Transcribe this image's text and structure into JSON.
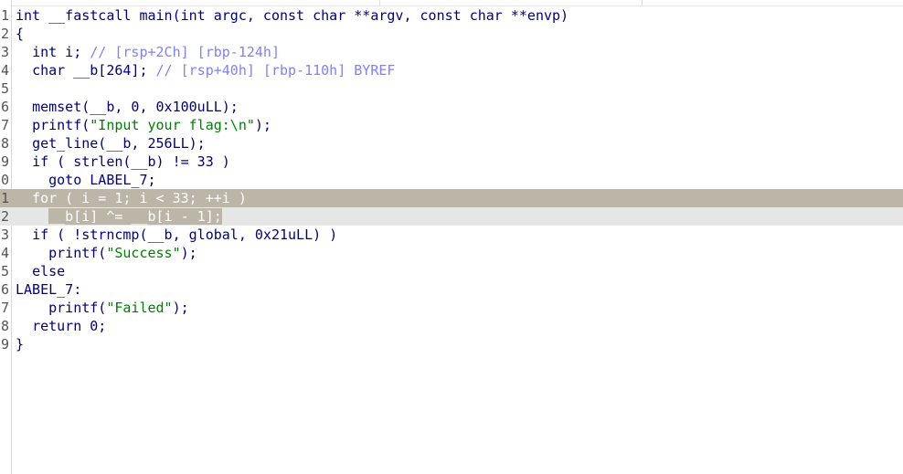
{
  "code_lines": [
    {
      "num": "1",
      "indent": "",
      "text": "int __fastcall main(int argc, const char **argv, const char **envp)",
      "comment": "",
      "str": ""
    },
    {
      "num": "2",
      "indent": "",
      "text": "{",
      "comment": "",
      "str": ""
    },
    {
      "num": "3",
      "indent": "  ",
      "text": "int i; ",
      "comment": "// [rsp+2Ch] [rbp-124h]",
      "str": ""
    },
    {
      "num": "4",
      "indent": "  ",
      "text": "char __b[264]; ",
      "comment": "// [rsp+40h] [rbp-110h] BYREF",
      "str": ""
    },
    {
      "num": "5",
      "indent": "",
      "text": "",
      "comment": "",
      "str": ""
    },
    {
      "num": "6",
      "indent": "  ",
      "text": "memset(__b, 0, 0x100uLL);",
      "comment": "",
      "str": ""
    },
    {
      "num": "7",
      "indent": "  ",
      "text": "printf(",
      "comment": "",
      "str": "\"Input your flag:\\n\"",
      "tail": ");"
    },
    {
      "num": "8",
      "indent": "  ",
      "text": "get_line(__b, 256LL);",
      "comment": "",
      "str": ""
    },
    {
      "num": "9",
      "indent": "  ",
      "text": "if ( strlen(__b) != 33 )",
      "comment": "",
      "str": ""
    },
    {
      "num": "0",
      "indent": "    ",
      "text": "goto LABEL_7;",
      "comment": "",
      "str": ""
    },
    {
      "num": "1",
      "indent": "  ",
      "text": "for ( i = 1; i < 33; ++i )",
      "comment": "",
      "str": "",
      "highlight": "current"
    },
    {
      "num": "2",
      "indent": "    ",
      "text": "__b[i] ^= __b[i - 1];",
      "comment": "",
      "str": "",
      "highlight": "selected"
    },
    {
      "num": "3",
      "indent": "  ",
      "text": "if ( !strncmp(__b, global, 0x21uLL) )",
      "comment": "",
      "str": ""
    },
    {
      "num": "4",
      "indent": "    ",
      "text": "printf(",
      "comment": "",
      "str": "\"Success\"",
      "tail": ");"
    },
    {
      "num": "5",
      "indent": "  ",
      "text": "else",
      "comment": "",
      "str": ""
    },
    {
      "num": "6",
      "indent": "",
      "text": "LABEL_7:",
      "comment": "",
      "str": ""
    },
    {
      "num": "7",
      "indent": "    ",
      "text": "printf(",
      "comment": "",
      "str": "\"Failed\"",
      "tail": ");"
    },
    {
      "num": "8",
      "indent": "  ",
      "text": "return 0;",
      "comment": "",
      "str": ""
    },
    {
      "num": "9",
      "indent": "",
      "text": "}",
      "comment": "",
      "str": ""
    }
  ],
  "colors": {
    "code": "#000080",
    "comment": "#8080ff",
    "string": "#008000",
    "current_line_bg": "#bbb6a8",
    "selected_line_bg": "#e6e6e6"
  }
}
